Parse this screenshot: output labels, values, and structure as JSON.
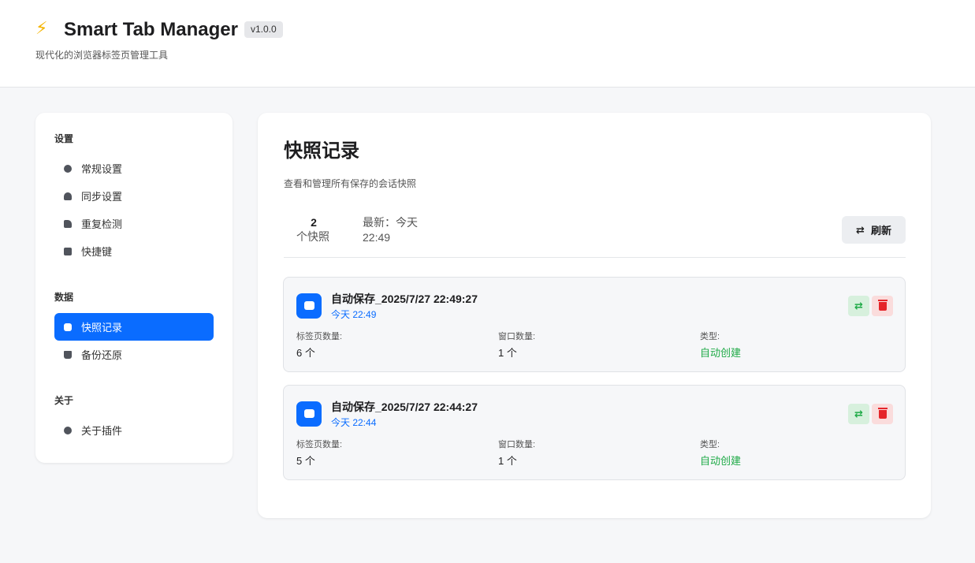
{
  "header": {
    "icon": "lightning-icon",
    "title": "Smart Tab Manager",
    "version": "v1.0.0",
    "subtitle": "现代化的浏览器标签页管理工具"
  },
  "sidebar": {
    "sections": [
      {
        "title": "设置",
        "items": [
          {
            "label": "常规设置",
            "icon": "gear-icon"
          },
          {
            "label": "同步设置",
            "icon": "cloud-icon"
          },
          {
            "label": "重复检测",
            "icon": "copy-icon"
          },
          {
            "label": "快捷键",
            "icon": "keyboard-icon"
          }
        ]
      },
      {
        "title": "数据",
        "items": [
          {
            "label": "快照记录",
            "icon": "camera-icon",
            "active": true
          },
          {
            "label": "备份还原",
            "icon": "archive-icon"
          }
        ]
      },
      {
        "title": "关于",
        "items": [
          {
            "label": "关于插件",
            "icon": "info-icon"
          }
        ]
      }
    ]
  },
  "main": {
    "title": "快照记录",
    "description": "查看和管理所有保存的会话快照",
    "stats": {
      "count": "2",
      "count_unit": "个快照",
      "latest": "最新：今天 22:49"
    },
    "refresh_label": "刷新",
    "snapshots": [
      {
        "name": "自动保存_2025/7/27 22:49:27",
        "time": "今天 22:49",
        "tabs_label": "标签页数量:",
        "tabs_value": "6 个",
        "windows_label": "窗口数量:",
        "windows_value": "1 个",
        "type_label": "类型:",
        "type_value": "自动创建"
      },
      {
        "name": "自动保存_2025/7/27 22:44:27",
        "time": "今天 22:44",
        "tabs_label": "标签页数量:",
        "tabs_value": "5 个",
        "windows_label": "窗口数量:",
        "windows_value": "1 个",
        "type_label": "类型:",
        "type_value": "自动创建"
      }
    ]
  },
  "colors": {
    "accent": "#0a6cff",
    "success": "#1faa47",
    "danger": "#e5252a",
    "background": "#f6f7f9"
  }
}
